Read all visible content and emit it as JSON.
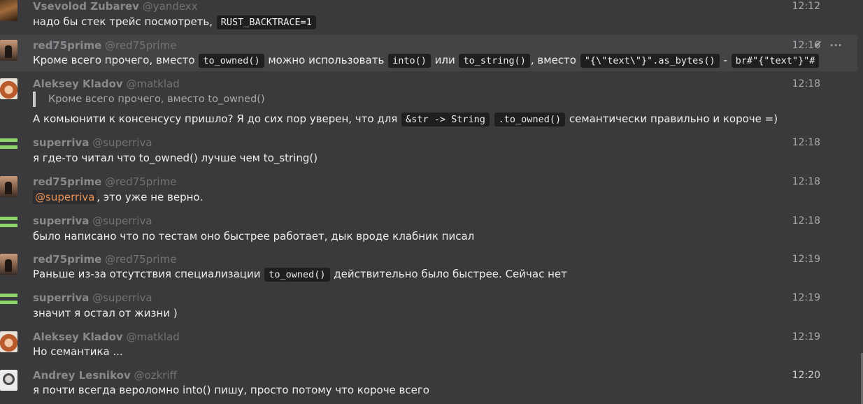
{
  "messages": [
    {
      "user": "Vsevolod Zubarev",
      "handle": "@yandexx",
      "time": "12:12",
      "text_before": "надо бы стек трейс посмотреть, ",
      "code1": "RUST_BACKTRACE=1"
    },
    {
      "user": "red75prime",
      "handle": "@red75prime",
      "time": "12:16",
      "check": "✔",
      "more": "•••",
      "t1": "Кроме всего прочего, вместо ",
      "c1": "to_owned()",
      "t2": " можно использовать ",
      "c2": "into()",
      "t3": " или ",
      "c3": "to_string()",
      "t4": ", вместо ",
      "c4": "\"{\\\"text\\\"}\".as_bytes()",
      "t5": " - ",
      "c5": "br#\"{\"text\"}\"#"
    },
    {
      "user": "Aleksey Kladov",
      "handle": "@matklad",
      "time": "12:18",
      "quote": "Кроме всего прочего, вместо to_owned()",
      "t1": "А комьюнити к консенсусу пришло? Я до сих пор уверен, что для ",
      "c1": "&str -> String",
      "t2": " ",
      "c2": ".to_owned()",
      "t3": " семантически правильно и короче =)"
    },
    {
      "user": "superriva",
      "handle": "@superriva",
      "time": "12:18",
      "text": "я где-то читал что to_owned() лучше чем to_string()"
    },
    {
      "user": "red75prime",
      "handle": "@red75prime",
      "time": "12:18",
      "mention": "@superriva",
      "text": ", это уже не верно."
    },
    {
      "user": "superriva",
      "handle": "@superriva",
      "time": "12:18",
      "text": "было написано что по тестам оно быстрее работает, дык вроде клабник писал"
    },
    {
      "user": "red75prime",
      "handle": "@red75prime",
      "time": "12:19",
      "t1": "Раньше из-за отсутствия специализации ",
      "c1": "to_owned()",
      "t2": " действительно было быстрее. Сейчас нет"
    },
    {
      "user": "superriva",
      "handle": "@superriva",
      "time": "12:19",
      "text": "значит я остал от жизни )"
    },
    {
      "user": "Aleksey Kladov",
      "handle": "@matklad",
      "time": "12:19",
      "text": "Но семантика ..."
    },
    {
      "user": "Andrey Lesnikov",
      "handle": "@ozkriff",
      "time": "12:20",
      "text": "я почти всегда вероломно into() пишу, просто потому что короче всего"
    }
  ]
}
